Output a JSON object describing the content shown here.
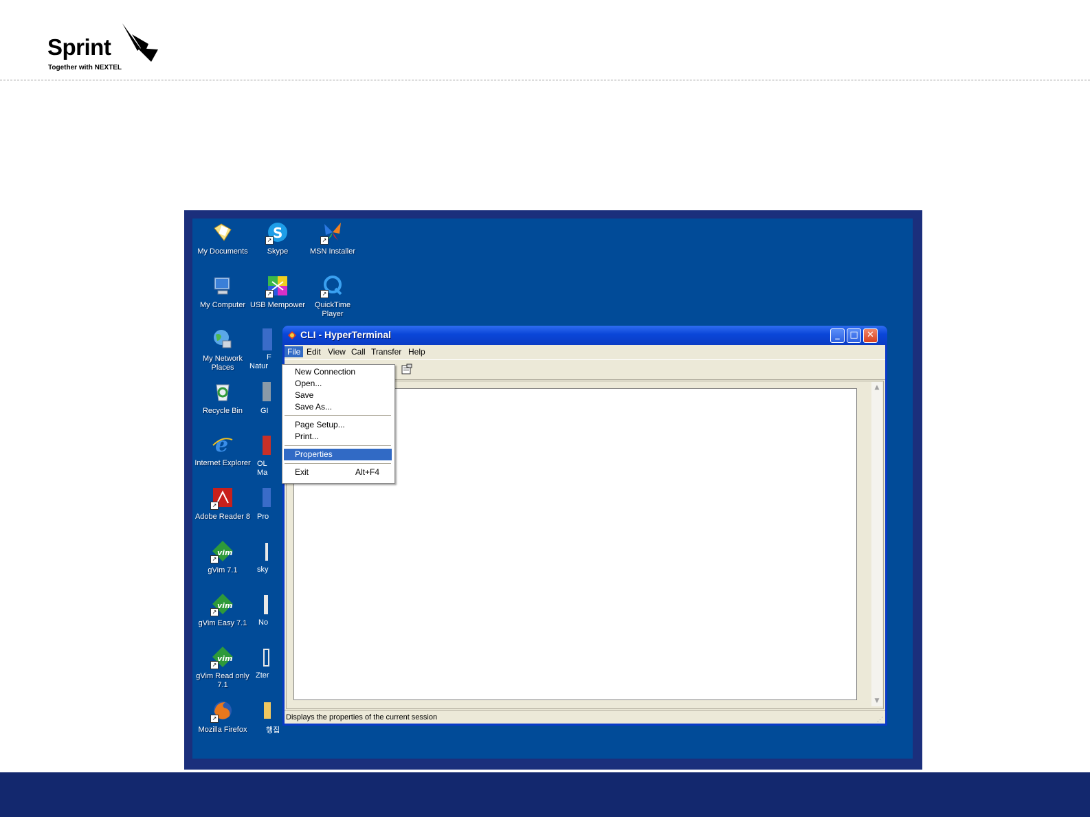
{
  "slide": {
    "logo_word": "Sprint",
    "logo_tagline": "Together with NEXTEL",
    "brand_color": "#13286e"
  },
  "desktop": {
    "background": "#014b98",
    "icons": [
      {
        "name": "my-documents",
        "label": "My Documents",
        "icon": "folder-documents-icon"
      },
      {
        "name": "skype",
        "label": "Skype",
        "icon": "skype-icon"
      },
      {
        "name": "msn-installer",
        "label": "MSN Installer",
        "icon": "msn-butterfly-icon"
      },
      {
        "name": "my-computer",
        "label": "My Computer",
        "icon": "computer-icon"
      },
      {
        "name": "usb-mempower",
        "label": "USB Mempower",
        "icon": "usb-mempower-icon"
      },
      {
        "name": "quicktime-player",
        "label": "QuickTime Player",
        "icon": "quicktime-icon"
      },
      {
        "name": "my-network-places",
        "label": "My Network Places",
        "icon": "network-globe-icon"
      },
      {
        "name": "recycle-bin",
        "label": "Recycle Bin",
        "icon": "recycle-bin-icon"
      },
      {
        "name": "internet-explorer",
        "label": "Internet Explorer",
        "icon": "internet-explorer-icon"
      },
      {
        "name": "adobe-reader",
        "label": "Adobe Reader 8",
        "icon": "adobe-reader-icon"
      },
      {
        "name": "gvim",
        "label": "gVim 7.1",
        "icon": "gvim-icon"
      },
      {
        "name": "gvim-easy",
        "label": "gVim Easy 7.1",
        "icon": "gvim-icon"
      },
      {
        "name": "gvim-read-only",
        "label": "gVim Read only 7.1",
        "icon": "gvim-icon"
      },
      {
        "name": "mozilla-firefox",
        "label": "Mozilla Firefox",
        "icon": "firefox-icon"
      }
    ],
    "partial_labels": [
      "F",
      "Natur",
      "GI",
      "OL",
      "Ma",
      "Pro",
      "sky",
      "No",
      "Zter",
      "행집"
    ]
  },
  "window": {
    "title": "CLI - HyperTerminal",
    "controls": {
      "minimize": "_",
      "maximize": "□",
      "close": "✕"
    },
    "menu": [
      "File",
      "Edit",
      "View",
      "Call",
      "Transfer",
      "Help"
    ],
    "active_menu": "File",
    "status_text": "Displays the properties of the current session"
  },
  "file_menu": {
    "items": [
      {
        "label": "New Connection",
        "accel": ""
      },
      {
        "label": "Open...",
        "accel": ""
      },
      {
        "label": "Save",
        "accel": ""
      },
      {
        "label": "Save As...",
        "accel": ""
      },
      {
        "label": "Page Setup...",
        "accel": ""
      },
      {
        "label": "Print...",
        "accel": ""
      },
      {
        "label": "Properties",
        "accel": ""
      },
      {
        "label": "Exit",
        "accel": "Alt+F4"
      }
    ],
    "highlighted": "Properties"
  }
}
